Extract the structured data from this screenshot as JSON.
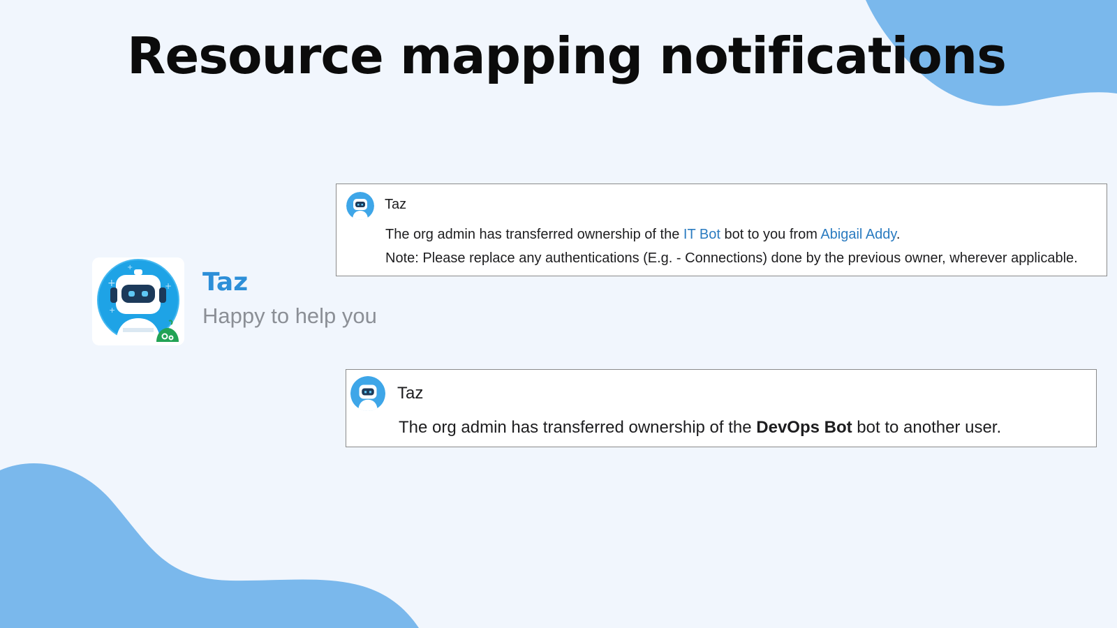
{
  "slide": {
    "title": "Resource mapping notifications"
  },
  "profile": {
    "name": "Taz",
    "tagline": "Happy to help you"
  },
  "notification_1": {
    "sender": "Taz",
    "line1_prefix": "The org admin has transferred ownership of the ",
    "bot_name": "IT Bot",
    "line1_middle": " bot to you from ",
    "from_user": "Abigail Addy",
    "line1_suffix": ".",
    "note": "Note: Please replace any authentications (E.g. - Connections) done by the previous owner, wherever applicable."
  },
  "notification_2": {
    "sender": "Taz",
    "line_prefix": "The org admin has transferred ownership of the ",
    "bot_name": "DevOps Bot",
    "line_suffix": " bot to another user."
  },
  "colors": {
    "background": "#f1f6fd",
    "blob": "#7ab8ec",
    "accent": "#2d8fd8",
    "link": "#2a7bc0",
    "tagline": "#8b8f96"
  },
  "icons": {
    "bot_avatar": "robot-avatar-icon",
    "status_badge": "green-chat-badge-icon"
  }
}
